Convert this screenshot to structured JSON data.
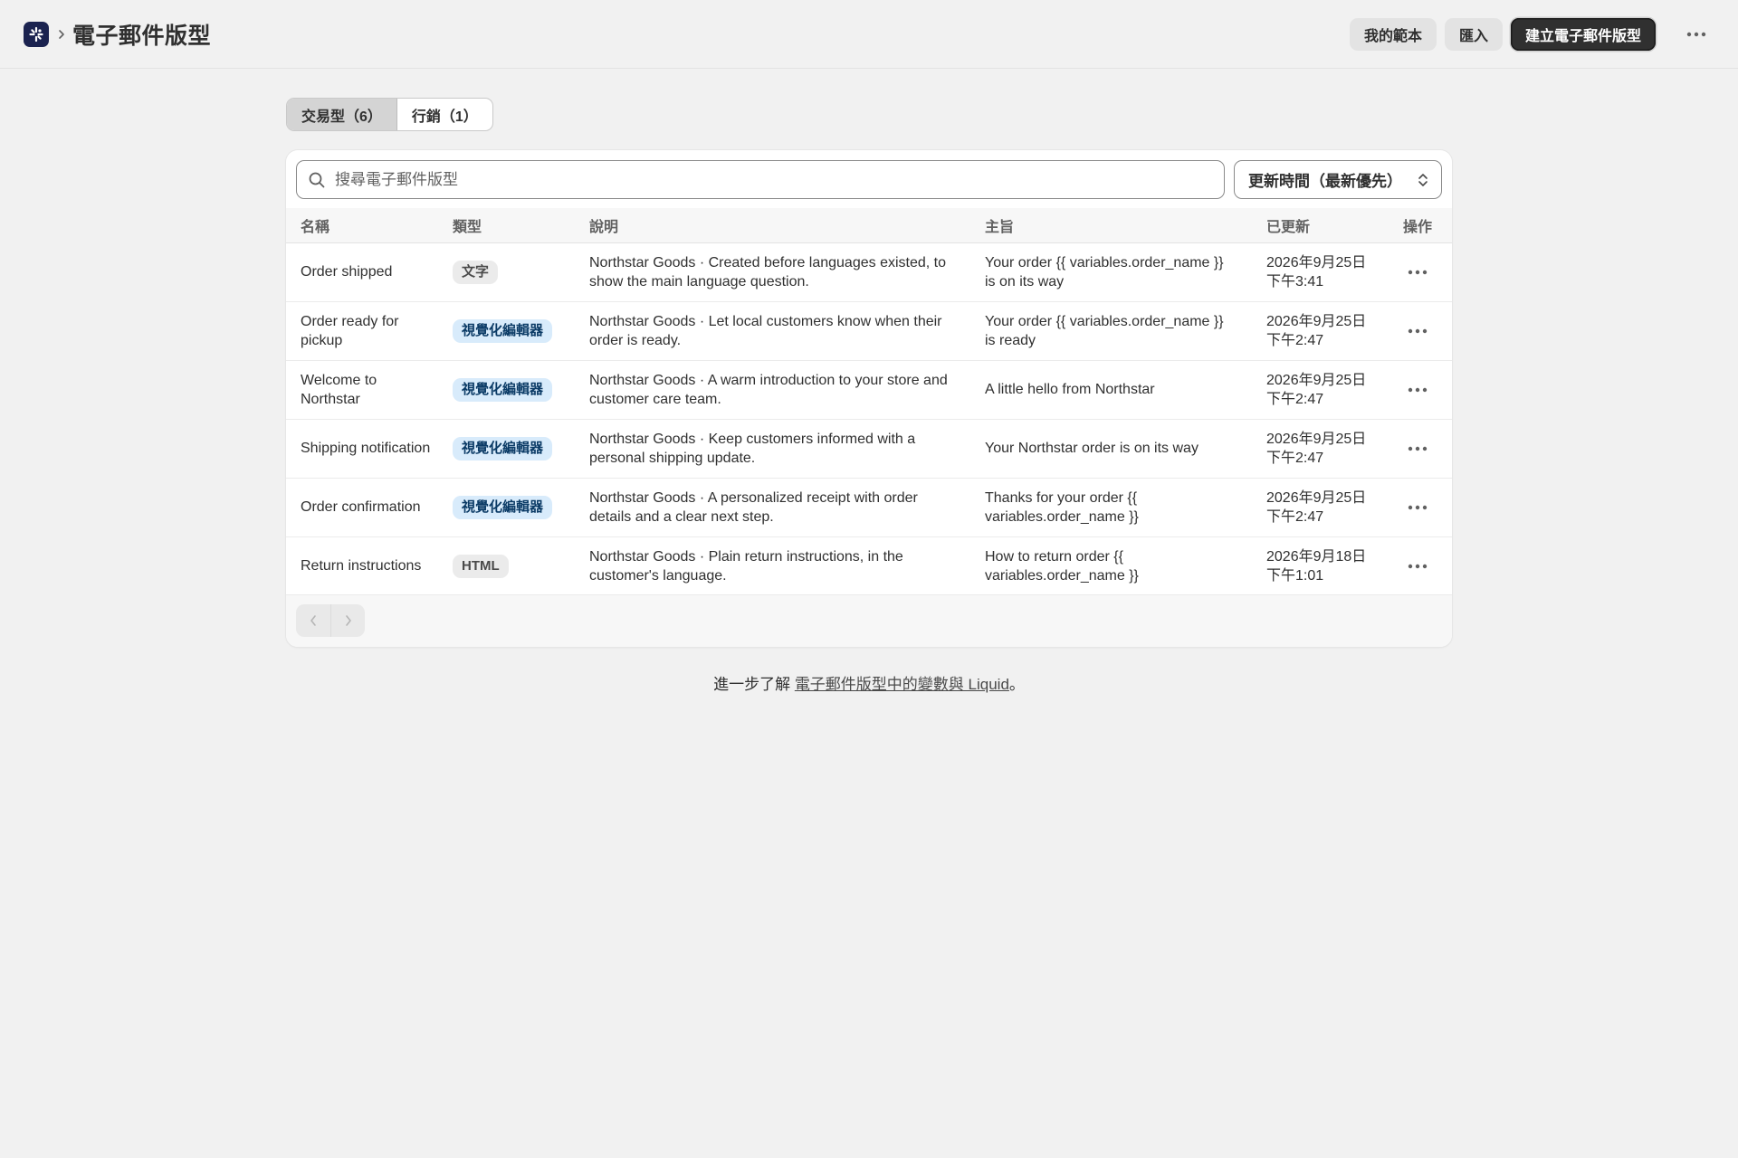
{
  "header": {
    "title": "電子郵件版型",
    "buttons": {
      "my_templates": "我的範本",
      "import": "匯入",
      "create": "建立電子郵件版型"
    }
  },
  "tabs": [
    {
      "label": "交易型（6）",
      "active": true
    },
    {
      "label": "行銷（1）",
      "active": false
    }
  ],
  "search": {
    "placeholder": "搜尋電子郵件版型",
    "value": ""
  },
  "sort": {
    "label": "更新時間（最新優先）"
  },
  "table": {
    "columns": [
      "名稱",
      "類型",
      "說明",
      "主旨",
      "已更新",
      "操作"
    ],
    "rows": [
      {
        "name": "Order shipped",
        "type": "文字",
        "type_kind": "text",
        "description": "Northstar Goods · Created before languages existed, to show the main language question.",
        "subject": "Your order {{ variables.order_name }} is on its way",
        "updated_date": "2026年9月25日",
        "updated_time": "下午3:41"
      },
      {
        "name": "Order ready for pickup",
        "type": "視覺化編輯器",
        "type_kind": "visual",
        "description": "Northstar Goods · Let local customers know when their order is ready.",
        "subject": "Your order {{ variables.order_name }} is ready",
        "updated_date": "2026年9月25日",
        "updated_time": "下午2:47"
      },
      {
        "name": "Welcome to Northstar",
        "type": "視覺化編輯器",
        "type_kind": "visual",
        "description": "Northstar Goods · A warm introduction to your store and customer care team.",
        "subject": "A little hello from Northstar",
        "updated_date": "2026年9月25日",
        "updated_time": "下午2:47"
      },
      {
        "name": "Shipping notification",
        "type": "視覺化編輯器",
        "type_kind": "visual",
        "description": "Northstar Goods · Keep customers informed with a personal shipping update.",
        "subject": "Your Northstar order is on its way",
        "updated_date": "2026年9月25日",
        "updated_time": "下午2:47"
      },
      {
        "name": "Order confirmation",
        "type": "視覺化編輯器",
        "type_kind": "visual",
        "description": "Northstar Goods · A personalized receipt with order details and a clear next step.",
        "subject": "Thanks for your order {{ variables.order_name }}",
        "updated_date": "2026年9月25日",
        "updated_time": "下午2:47"
      },
      {
        "name": "Return instructions",
        "type": "HTML",
        "type_kind": "html",
        "description": "Northstar Goods · Plain return instructions, in the customer's language.",
        "subject": "How to return order {{ variables.order_name }}",
        "updated_date": "2026年9月18日",
        "updated_time": "下午1:01"
      }
    ]
  },
  "footer": {
    "prefix": "進一步了解 ",
    "link": "電子郵件版型中的變數與 Liquid",
    "suffix": "。"
  },
  "colors": {
    "background": "#f1f1f1",
    "primary_button": "#303030",
    "logo": "#1b2350",
    "badge_visual_bg": "#d8ebfb",
    "badge_visual_text": "#0b3b66"
  }
}
